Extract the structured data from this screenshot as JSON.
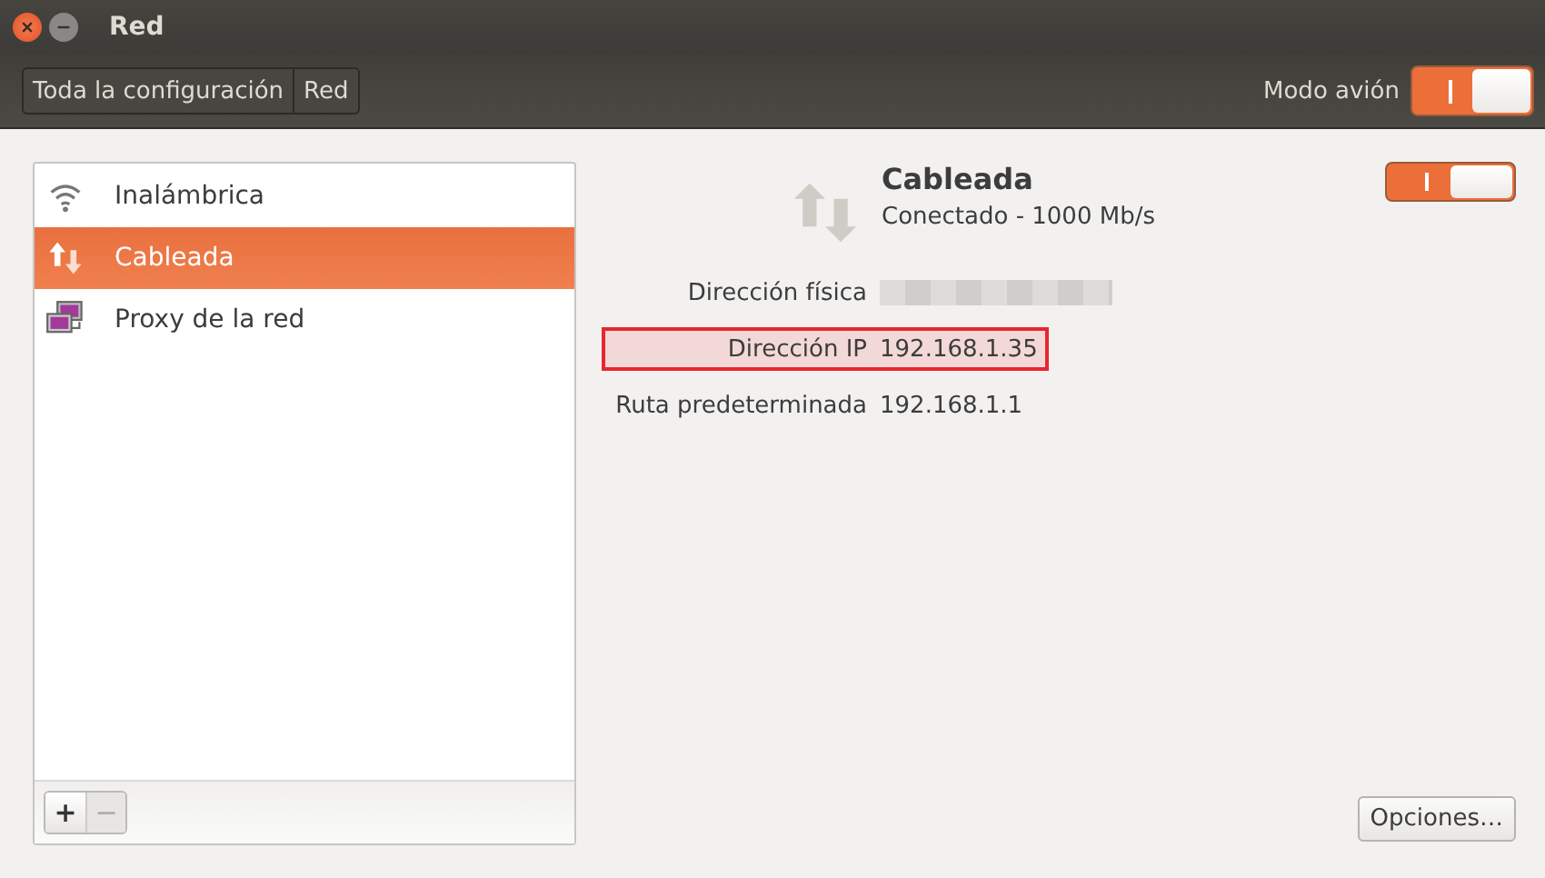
{
  "window": {
    "title": "Red"
  },
  "breadcrumbs": [
    {
      "label": "Toda la configuración"
    },
    {
      "label": "Red"
    }
  ],
  "airplane_mode": {
    "label": "Modo avión",
    "on": true
  },
  "sidebar": {
    "items": [
      {
        "label": "Inalámbrica",
        "kind": "wifi",
        "selected": false
      },
      {
        "label": "Cableada",
        "kind": "wired",
        "selected": true
      },
      {
        "label": "Proxy de la red",
        "kind": "proxy",
        "selected": false
      }
    ],
    "buttons": [
      {
        "label": "+",
        "disabled": false
      },
      {
        "label": "−",
        "disabled": true
      }
    ]
  },
  "detail": {
    "title": "Cableada",
    "status": "Conectado - 1000 Mb/s",
    "on": true,
    "fields": [
      {
        "label": "Dirección física",
        "redacted": true,
        "highlighted": false
      },
      {
        "label": "Dirección IP",
        "value": "192.168.1.35",
        "redacted": false,
        "highlighted": true
      },
      {
        "label": "Ruta predeterminada",
        "value": "192.168.1.1",
        "redacted": false,
        "highlighted": false
      }
    ]
  },
  "options_button": {
    "label": "Opciones…"
  }
}
